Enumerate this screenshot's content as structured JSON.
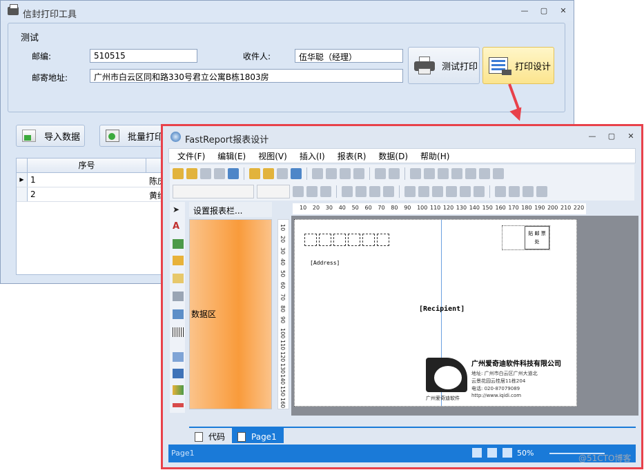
{
  "main_window": {
    "title": "信封打印工具",
    "panel_title": "测试",
    "zip_label": "邮编:",
    "zip_value": "510515",
    "recipient_label": "收件人:",
    "recipient_value": "伍华聪（经理）",
    "address_label": "邮寄地址:",
    "address_value": "广州市白云区同和路330号君立公寓B栋1803房",
    "test_print_label": "测试打印",
    "print_design_label": "打印设计",
    "import_label": "导入数据",
    "batch_print_label": "批量打印",
    "grid": {
      "header_seq": "序号",
      "rows": [
        {
          "seq": "1",
          "name": "陈庆"
        },
        {
          "seq": "2",
          "name": "黄维"
        }
      ]
    }
  },
  "fastreport": {
    "title": "FastReport报表设计",
    "menu": [
      "文件(F)",
      "编辑(E)",
      "视图(V)",
      "插入(I)",
      "报表(R)",
      "数据(D)",
      "帮助(H)"
    ],
    "band_header": "设置报表栏...",
    "band_label": "数据区",
    "hruler_ticks": [
      "10",
      "20",
      "30",
      "40",
      "50",
      "60",
      "70",
      "80",
      "90",
      "100",
      "110",
      "120",
      "130",
      "140",
      "150",
      "160",
      "170",
      "180",
      "190",
      "200",
      "210",
      "220"
    ],
    "vruler_ticks": [
      "10",
      "20",
      "30",
      "40",
      "50",
      "60",
      "70",
      "80",
      "90",
      "100",
      "110",
      "120",
      "130",
      "140",
      "150",
      "160"
    ],
    "page": {
      "address_field": "[Address]",
      "recipient_field": "[Recipient]",
      "stamp_text": "贴 邮 票 处",
      "company_name": "广州爱奇迪软件科技有限公司",
      "company_logo_text": "广州爱奇迪软件",
      "company_lines": [
        "地址: 广州市白云区广州大道北",
        "云景花园云桂居11栋204",
        "电话: 020-87079089",
        "http://www.iqidi.com"
      ]
    },
    "tabs": [
      {
        "label": "代码",
        "active": false
      },
      {
        "label": "Page1",
        "active": true
      }
    ],
    "status_left": "Page1",
    "zoom": "50%"
  },
  "watermark": "@51CTO博客",
  "colors": {
    "highlight_border": "#e8414a",
    "status_bar": "#1a7ad8",
    "band": "#f99b3b"
  }
}
